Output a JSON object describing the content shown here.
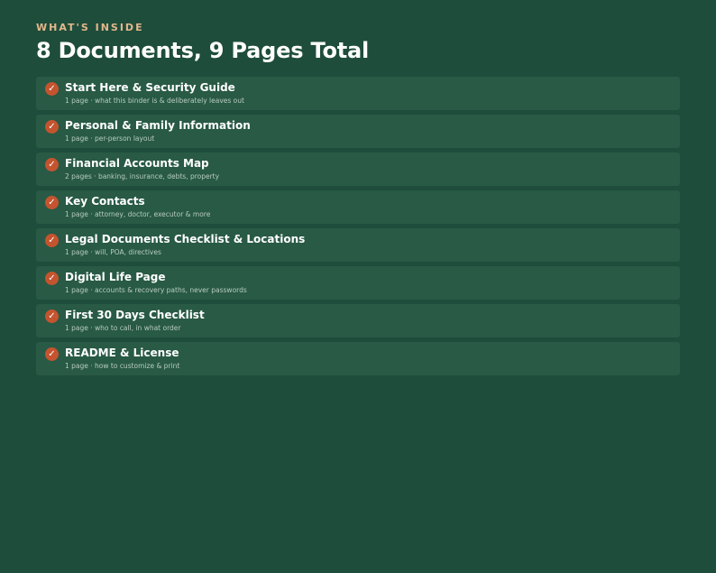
{
  "header": {
    "eyebrow": "WHAT'S INSIDE",
    "title": "8 Documents, 9 Pages Total"
  },
  "colors": {
    "background": "#1e4d3b",
    "card": "#285a45",
    "accent": "#c4542f",
    "eyebrow": "#e3b78b"
  },
  "items": [
    {
      "icon": "check-icon",
      "title": "Start Here & Security Guide",
      "subtitle": "1 page · what this binder is & deliberately leaves out"
    },
    {
      "icon": "check-icon",
      "title": "Personal & Family Information",
      "subtitle": "1 page · per-person layout"
    },
    {
      "icon": "check-icon",
      "title": "Financial Accounts Map",
      "subtitle": "2 pages · banking, insurance, debts, property"
    },
    {
      "icon": "check-icon",
      "title": "Key Contacts",
      "subtitle": "1 page · attorney, doctor, executor & more"
    },
    {
      "icon": "check-icon",
      "title": "Legal Documents Checklist & Locations",
      "subtitle": "1 page · will, POA, directives"
    },
    {
      "icon": "check-icon",
      "title": "Digital Life Page",
      "subtitle": "1 page · accounts & recovery paths, never passwords"
    },
    {
      "icon": "check-icon",
      "title": "First 30 Days Checklist",
      "subtitle": "1 page · who to call, in what order"
    },
    {
      "icon": "check-icon",
      "title": "README & License",
      "subtitle": "1 page · how to customize & print"
    }
  ]
}
